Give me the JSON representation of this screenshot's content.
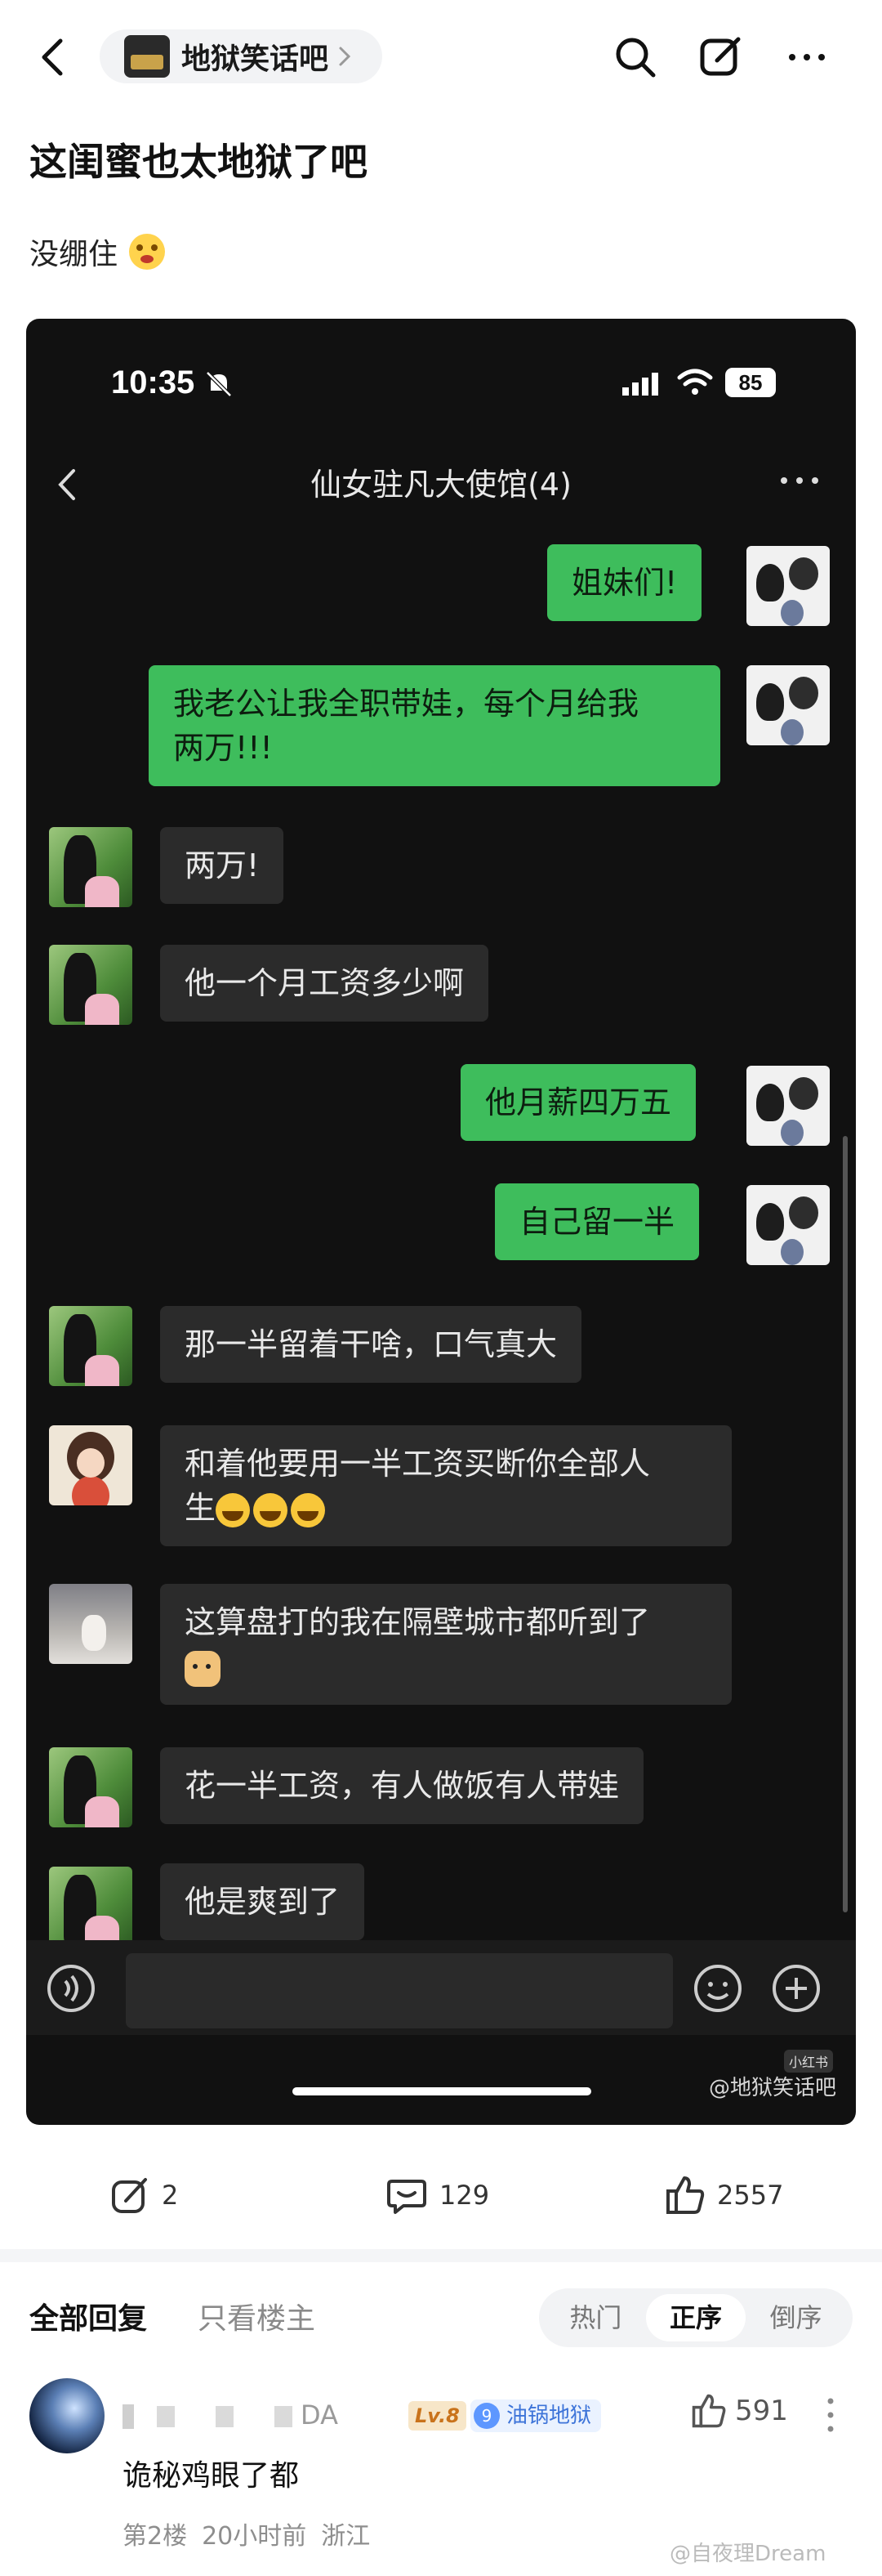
{
  "nav": {
    "forum_name": "地狱笑话吧",
    "forum_logo_text": "地狱笑话"
  },
  "post": {
    "title": "这闺蜜也太地狱了吧",
    "body": "没绷住"
  },
  "screenshot": {
    "time": "10:35",
    "battery": "85",
    "chat_title": "仙女驻凡大使馆(4)",
    "messages": [
      {
        "side": "me",
        "text": "姐妹们!"
      },
      {
        "side": "me",
        "text": "我老公让我全职带娃，每个月给我",
        "text2": "两万!!!"
      },
      {
        "side": "other",
        "text": "两万!"
      },
      {
        "side": "other",
        "text": "他一个月工资多少啊"
      },
      {
        "side": "me",
        "text": "他月薪四万五"
      },
      {
        "side": "me",
        "text": "自己留一半"
      },
      {
        "side": "other",
        "text": "那一半留着干啥，口气真大"
      },
      {
        "side": "other",
        "text": "和着他要用一半工资买断你全部人",
        "text2": "生"
      },
      {
        "side": "other",
        "text": "这算盘打的我在隔壁城市都听到了"
      },
      {
        "side": "other",
        "text": "花一半工资，有人做饭有人带娃"
      },
      {
        "side": "other",
        "text": "他是爽到了"
      }
    ],
    "watermark": "@地狱笑话吧",
    "source_tag": "小红书"
  },
  "actions": {
    "share_count": "2",
    "comment_count": "129",
    "like_count": "2557"
  },
  "replies": {
    "tab_all": "全部回复",
    "tab_op": "只看楼主",
    "sort": [
      "热门",
      "正序",
      "倒序"
    ],
    "sort_active": "正序"
  },
  "comment": {
    "name_suffix": "DA",
    "level": "Lv.8",
    "forum_badge_num": "9",
    "forum_badge": "油锅地狱",
    "likes": "591",
    "text": "诡秘鸡眼了都",
    "floor": "第2楼",
    "time": "20小时前",
    "location": "浙江"
  },
  "site_watermark": "@自夜理Dream",
  "colors": {
    "wechat_green": "#3ebd5c",
    "chat_bg": "#111111",
    "accent_blue": "#3d74d9"
  }
}
